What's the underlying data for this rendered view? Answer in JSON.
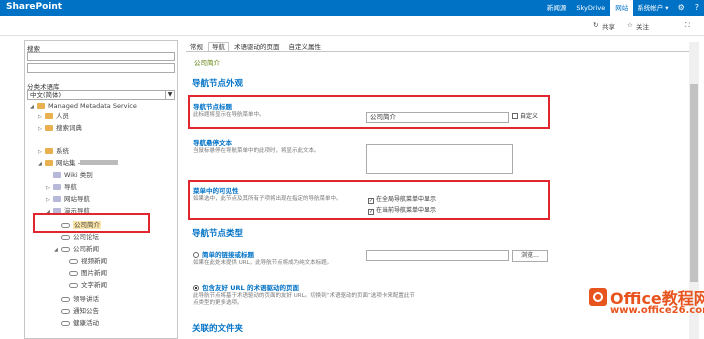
{
  "suitebar": {
    "brand": "SharePoint",
    "links": [
      "新闻源",
      "SkyDrive",
      "网站"
    ],
    "account": "系统帐户 ▾",
    "settings_icon": "gear-icon",
    "help": "?"
  },
  "ribbon": {
    "share": "共享",
    "follow": "关注",
    "focus_icon": "focus-icon"
  },
  "left": {
    "search_label": "搜索",
    "termstore_label": "分类术语库",
    "language": "中文(简体)",
    "nodes": [
      "Managed Metadata Service",
      "人员",
      "搜索词典",
      "系统",
      "网站集 -",
      "Wiki 类别",
      "导航",
      "网站导航",
      "演示导航",
      "公司简介",
      "公司论坛",
      "公司新闻",
      "视频新闻",
      "图片新闻",
      "文字新闻",
      "领导讲话",
      "通知公告",
      "健康活动"
    ]
  },
  "tabs": [
    "常规",
    "导航",
    "术语驱动的页面",
    "自定义属性"
  ],
  "breadcrumb": "公司简介",
  "sections": {
    "appearance": "导航节点外观",
    "nodetype": "导航节点类型",
    "folders": "关联的文件夹"
  },
  "title_field": {
    "label": "导航节点标题",
    "desc": "此标题将显示在导航菜单中。",
    "value": "公司简介",
    "custom": "自定义"
  },
  "hover_field": {
    "label": "导航悬停文本",
    "desc": "当鼠标悬停在导航菜单中的此项时，将显示此文本。"
  },
  "visibility": {
    "label": "菜单中的可见性",
    "desc": "如果选中，此节点及其所有子项将出现在指定的导航菜单中。",
    "global": "在全局导航菜单中显示",
    "current": "在当前导航菜单中显示"
  },
  "link_option": {
    "label": "简单的链接或标题",
    "desc": "如果在此处未提供 URL，此导航节点将成为纯文本标题。",
    "browse": "浏览..."
  },
  "friendly_option": {
    "label": "包含友好 URL 的术语驱动的页面",
    "desc": "此导航节点将基于术语驱动的页面的友好 URL。切换到“术语驱动的页面”选项卡来配置此节点类型的更多选项。"
  },
  "watermark": {
    "line1": "Office教程网",
    "line2": "www.office26.com"
  }
}
